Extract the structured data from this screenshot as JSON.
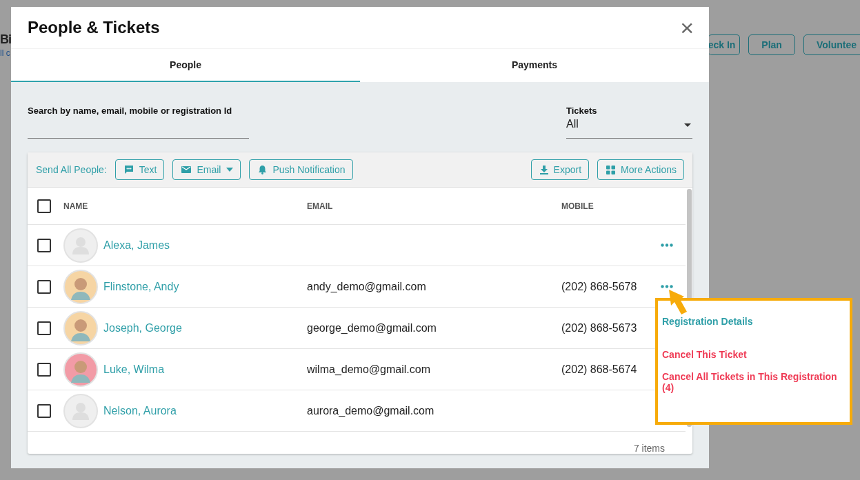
{
  "background_page": {
    "title": "Bi",
    "subtitle": "ll c",
    "buttons": [
      "eck In",
      "Plan",
      "Voluntee"
    ]
  },
  "dialog": {
    "title": "People & Tickets",
    "close": "×"
  },
  "tabs": [
    {
      "label": "People",
      "selected": true
    },
    {
      "label": "Payments",
      "selected": false
    }
  ],
  "search": {
    "label": "Search by name, email, mobile or registration Id"
  },
  "tickets_filter": {
    "label": "Tickets",
    "value": "All"
  },
  "toolbar": {
    "label": "Send All People:",
    "left_buttons": [
      {
        "kind": "text",
        "label": "Text"
      },
      {
        "kind": "email",
        "label": "Email"
      },
      {
        "kind": "push",
        "label": "Push Notification"
      }
    ],
    "right_buttons": [
      {
        "kind": "export",
        "label": "Export"
      },
      {
        "kind": "more",
        "label": "More Actions"
      }
    ]
  },
  "table": {
    "select_all": {
      "checked": false
    },
    "columns": [
      "NAME",
      "EMAIL",
      "MOBILE"
    ],
    "rows": [
      {
        "checked": false,
        "avatar": {
          "kind": "placeholder"
        },
        "name": "Alexa, James",
        "email": "",
        "mobile": ""
      },
      {
        "checked": false,
        "avatar": {
          "kind": "illustration",
          "color": "#f6d5a4"
        },
        "name": "Flinstone, Andy",
        "email": "andy_demo@gmail.com",
        "mobile": "(202) 868-5678"
      },
      {
        "checked": false,
        "avatar": {
          "kind": "illustration",
          "color": "#f6d5a4"
        },
        "name": "Joseph, George",
        "email": "george_demo@gmail.com",
        "mobile": "(202) 868-5673"
      },
      {
        "checked": false,
        "avatar": {
          "kind": "illustration",
          "color": "#f29ba6"
        },
        "name": "Luke, Wilma",
        "email": "wilma_demo@gmail.com",
        "mobile": "(202) 868-5674"
      },
      {
        "checked": false,
        "avatar": {
          "kind": "placeholder"
        },
        "name": "Nelson, Aurora",
        "email": "aurora_demo@gmail.com",
        "mobile": ""
      }
    ],
    "footer": "7 items"
  },
  "row_menu": {
    "items": [
      {
        "kind": "normal",
        "label": "Registration Details"
      },
      {
        "kind": "danger",
        "label": "Cancel This Ticket"
      },
      {
        "kind": "danger",
        "label": "Cancel All Tickets in This Registration (4)"
      }
    ]
  }
}
